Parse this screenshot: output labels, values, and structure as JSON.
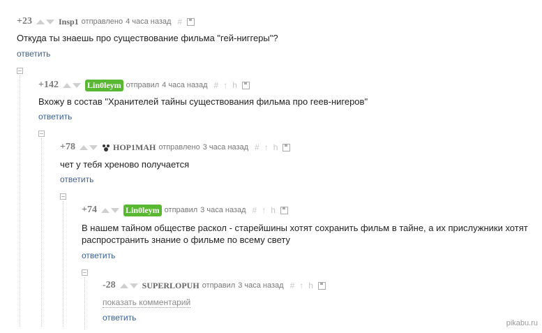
{
  "comments": [
    {
      "rating": "+23",
      "user": "Insp1",
      "action": "отправлено",
      "time": "4 часа назад",
      "text": "Откуда ты знаешь про существование фильма \"гей-ниггеры\"?",
      "reply": "ответить"
    },
    {
      "rating": "+142",
      "user": "Lin0leym",
      "action": "отправил",
      "time": "4 часа назад",
      "text": "Вхожу в состав \"Хранителей тайны существования фильма про геев-нигеров\"",
      "reply": "ответить"
    },
    {
      "rating": "+78",
      "user": "HOP1MAH",
      "action": "отправлено",
      "time": "3 часа назад",
      "text": "чет у тебя хреново получается",
      "reply": "ответить"
    },
    {
      "rating": "+74",
      "user": "Lin0leym",
      "action": "отправил",
      "time": "3 часа назад",
      "text": "В нашем тайном обществе раскол - старейшины хотят сохранить фильм в тайне, а их прислужники хотят распространить знание о фильме по всему свету",
      "reply": "ответить"
    },
    {
      "rating": "-28",
      "user": "SUPERLOPUH",
      "action": "отправил",
      "time": "3 часа назад",
      "show": "показать комментарий",
      "reply": "ответить"
    }
  ],
  "tools": {
    "hash": "#",
    "pin": "↑",
    "branch": "h"
  },
  "watermark": "pikabu.ru",
  "colors": {
    "badge": "#58b832",
    "link": "#3b5f93"
  }
}
